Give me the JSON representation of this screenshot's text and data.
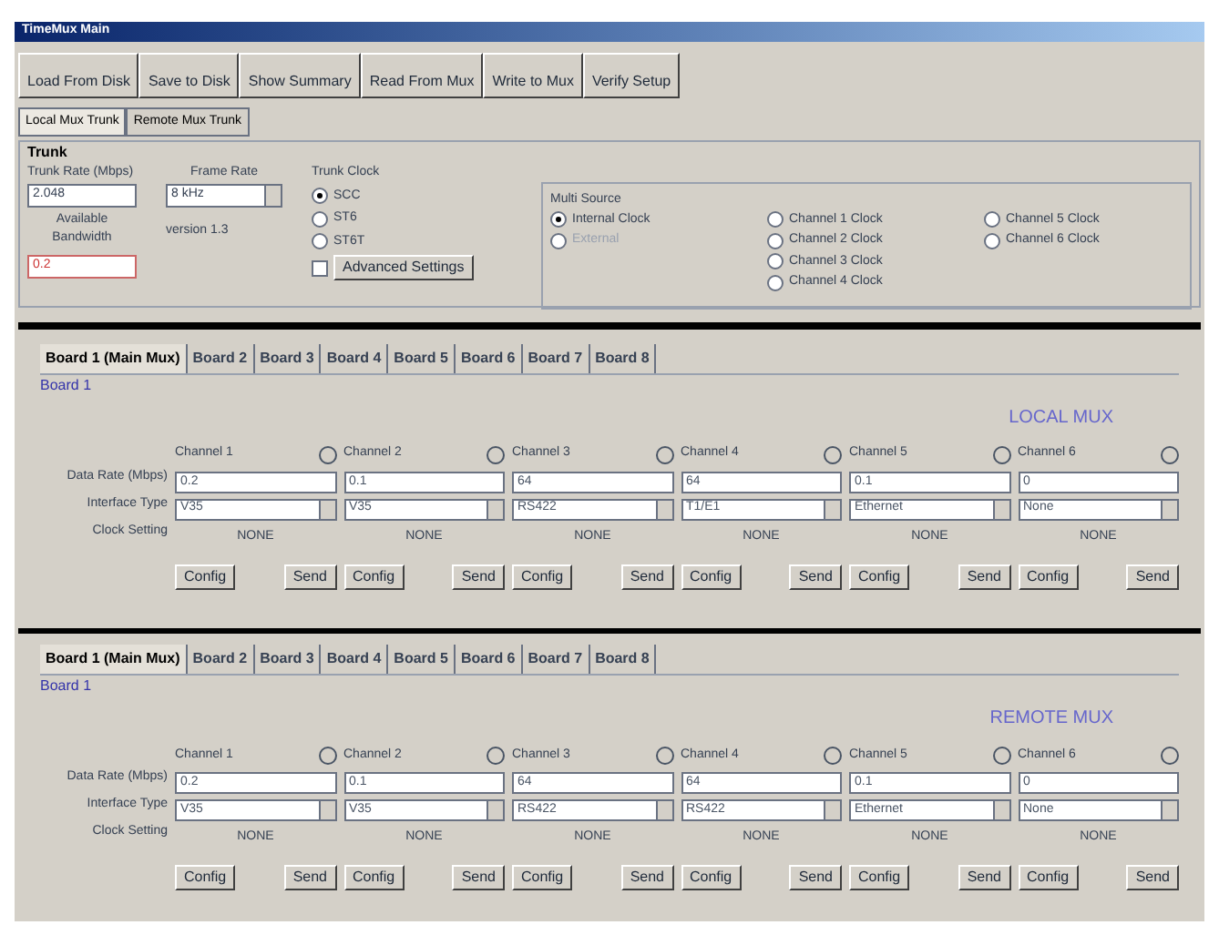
{
  "window": {
    "title": "TimeMux Main"
  },
  "toolbar": [
    "Load From Disk",
    "Save to Disk",
    "Show Summary",
    "Read From Mux",
    "Write to Mux",
    "Verify Setup"
  ],
  "tabs": [
    {
      "label": "Local Mux Trunk",
      "selected": true
    },
    {
      "label": "Remote Mux Trunk",
      "selected": false
    }
  ],
  "trunk": {
    "title": "Trunk",
    "rate_label": "Trunk Rate (Mbps)",
    "rate_value": "2.048",
    "frame_label": "Frame Rate",
    "frame_value": "8 kHz",
    "bw_label": "Available Bandwidth",
    "bw_value": "0.2",
    "version": "version 1.3",
    "clock_title": "Trunk Clock",
    "clocks": [
      {
        "label": "SCC",
        "selected": true
      },
      {
        "label": "ST6",
        "selected": false
      },
      {
        "label": "ST6T",
        "selected": false
      }
    ],
    "advanced": {
      "label": "Advanced Settings",
      "checked": false
    },
    "multi_title": "Multi Source",
    "multi": [
      {
        "label": "Internal Clock",
        "selected": true,
        "disabled": false
      },
      {
        "label": "External",
        "selected": false,
        "disabled": true
      },
      {
        "label": "Channel 1 Clock",
        "selected": false,
        "disabled": false
      },
      {
        "label": "Channel 2 Clock",
        "selected": false,
        "disabled": false
      },
      {
        "label": "Channel 3 Clock",
        "selected": false,
        "disabled": false
      },
      {
        "label": "Channel 4 Clock",
        "selected": false,
        "disabled": false
      },
      {
        "label": "Channel 5 Clock",
        "selected": false,
        "disabled": false
      },
      {
        "label": "Channel 6 Clock",
        "selected": false,
        "disabled": false
      }
    ]
  },
  "panels": [
    {
      "boards": [
        {
          "label": "Board 1 (Main Mux)",
          "selected": true
        },
        {
          "label": "Board 2",
          "selected": false
        },
        {
          "label": "Board 3",
          "selected": false
        },
        {
          "label": "Board 4",
          "selected": false
        },
        {
          "label": "Board 5",
          "selected": false
        },
        {
          "label": "Board 6",
          "selected": false
        },
        {
          "label": "Board 7",
          "selected": false
        },
        {
          "label": "Board 8",
          "selected": false
        }
      ],
      "board_label": "Board 1",
      "mux_label": "LOCAL MUX",
      "row_labels": [
        "Data Rate (Mbps)",
        "Interface Type",
        "Clock Setting"
      ],
      "channels": [
        {
          "name": "Channel 1",
          "rate": "0.2",
          "type": "V35",
          "clock": "NONE",
          "config": "Config",
          "send": "Send"
        },
        {
          "name": "Channel 2",
          "rate": "0.1",
          "type": "V35",
          "clock": "NONE",
          "config": "Config",
          "send": "Send"
        },
        {
          "name": "Channel 3",
          "rate": "64",
          "type": "RS422",
          "clock": "NONE",
          "config": "Config",
          "send": "Send"
        },
        {
          "name": "Channel 4",
          "rate": "64",
          "type": "T1/E1",
          "clock": "NONE",
          "config": "Config",
          "send": "Send"
        },
        {
          "name": "Channel 5",
          "rate": "0.1",
          "type": "Ethernet",
          "clock": "NONE",
          "config": "Config",
          "send": "Send"
        },
        {
          "name": "Channel 6",
          "rate": "0",
          "type": "None",
          "clock": "NONE",
          "config": "Config",
          "send": "Send"
        }
      ]
    },
    {
      "boards": [
        {
          "label": "Board 1 (Main Mux)",
          "selected": true
        },
        {
          "label": "Board 2",
          "selected": false
        },
        {
          "label": "Board 3",
          "selected": false
        },
        {
          "label": "Board 4",
          "selected": false
        },
        {
          "label": "Board 5",
          "selected": false
        },
        {
          "label": "Board 6",
          "selected": false
        },
        {
          "label": "Board 7",
          "selected": false
        },
        {
          "label": "Board 8",
          "selected": false
        }
      ],
      "board_label": "Board 1",
      "mux_label": "REMOTE MUX",
      "row_labels": [
        "Data Rate (Mbps)",
        "Interface Type",
        "Clock Setting"
      ],
      "channels": [
        {
          "name": "Channel 1",
          "rate": "0.2",
          "type": "V35",
          "clock": "NONE",
          "config": "Config",
          "send": "Send"
        },
        {
          "name": "Channel 2",
          "rate": "0.1",
          "type": "V35",
          "clock": "NONE",
          "config": "Config",
          "send": "Send"
        },
        {
          "name": "Channel 3",
          "rate": "64",
          "type": "RS422",
          "clock": "NONE",
          "config": "Config",
          "send": "Send"
        },
        {
          "name": "Channel 4",
          "rate": "64",
          "type": "RS422",
          "clock": "NONE",
          "config": "Config",
          "send": "Send"
        },
        {
          "name": "Channel 5",
          "rate": "0.1",
          "type": "Ethernet",
          "clock": "NONE",
          "config": "Config",
          "send": "Send"
        },
        {
          "name": "Channel 6",
          "rate": "0",
          "type": "None",
          "clock": "NONE",
          "config": "Config",
          "send": "Send"
        }
      ]
    }
  ]
}
